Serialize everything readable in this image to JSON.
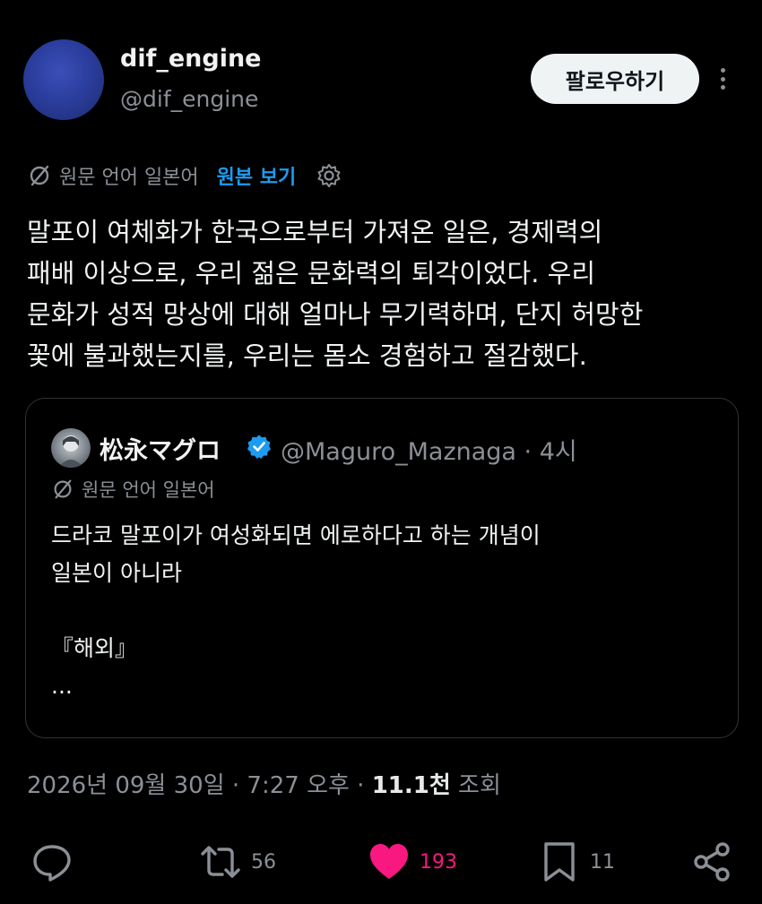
{
  "post": {
    "author_name": "dif_engine",
    "author_handle": "@dif_engine",
    "follow_label": "팔로우하기",
    "translation_notice": "원문 언어 일본어",
    "show_original_label": "원본 보기",
    "body_lines": [
      "말포이 여체화가 한국으로부터 가져온 일은, 경제력의",
      "패배 이상으로, 우리 젊은 문화력의 퇴각이었다. 우리",
      "문화가 성적 망상에 대해 얼마나 무기력하며, 단지 허망한",
      "꽃에 불과했는지를, 우리는 몸소 경험하고 절감했다."
    ],
    "timestamp": "2026년 09월 30일 · 7:27 오후 · ",
    "views_count": "11.1천",
    "views_label": " 조회"
  },
  "quoted": {
    "author_name": "松永マグロ",
    "author_handle": "@Maguro_Maznaga · 4시",
    "translation_notice": "원문 언어 일본어",
    "lines": [
      "드라코 말포이가 여성화되면 에로하다고 하는 개념이",
      "일본이 아니라",
      "",
      " 『해외』",
      "..."
    ]
  },
  "actions": {
    "replies": "",
    "reposts": "56",
    "likes": "193",
    "bookmarks": "11"
  },
  "colors": {
    "background": "#000000",
    "link": "#1d9bf0",
    "like": "#f91880",
    "muted": "#8b9096",
    "verified": "#1d9bf0"
  }
}
